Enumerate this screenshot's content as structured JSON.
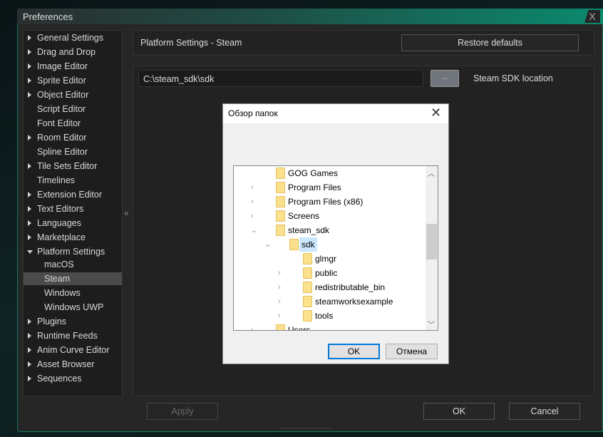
{
  "window": {
    "title": "Preferences",
    "close": "X"
  },
  "sidebar": {
    "items": [
      {
        "label": "General Settings",
        "arrow": "right"
      },
      {
        "label": "Drag and Drop",
        "arrow": "right"
      },
      {
        "label": "Image Editor",
        "arrow": "right"
      },
      {
        "label": "Sprite Editor",
        "arrow": "right"
      },
      {
        "label": "Object Editor",
        "arrow": "right"
      },
      {
        "label": "Script Editor",
        "arrow": ""
      },
      {
        "label": "Font Editor",
        "arrow": ""
      },
      {
        "label": "Room Editor",
        "arrow": "right"
      },
      {
        "label": "Spline Editor",
        "arrow": ""
      },
      {
        "label": "Tile Sets Editor",
        "arrow": "right"
      },
      {
        "label": "Timelines",
        "arrow": ""
      },
      {
        "label": "Extension Editor",
        "arrow": "right"
      },
      {
        "label": "Text Editors",
        "arrow": "right"
      },
      {
        "label": "Languages",
        "arrow": "right"
      },
      {
        "label": "Marketplace",
        "arrow": "right"
      },
      {
        "label": "Platform Settings",
        "arrow": "down"
      },
      {
        "label": "macOS",
        "sub": true
      },
      {
        "label": "Steam",
        "sub": true,
        "selected": true
      },
      {
        "label": "Windows",
        "sub": true
      },
      {
        "label": "Windows UWP",
        "sub": true
      },
      {
        "label": "Plugins",
        "arrow": "right"
      },
      {
        "label": "Runtime Feeds",
        "arrow": "right"
      },
      {
        "label": "Anim Curve Editor",
        "arrow": "right"
      },
      {
        "label": "Asset Browser",
        "arrow": "right"
      },
      {
        "label": "Sequences",
        "arrow": "right"
      }
    ],
    "collapse": "«"
  },
  "panel": {
    "title": "Platform Settings - Steam",
    "restore": "Restore defaults",
    "sdk_path": "C:\\steam_sdk\\sdk",
    "browse": "...",
    "sdk_label": "Steam SDK location"
  },
  "footer": {
    "apply": "Apply",
    "ok": "OK",
    "cancel": "Cancel"
  },
  "dialog": {
    "title": "Обзор папок",
    "close": "✕",
    "ok": "OK",
    "cancel": "Отмена",
    "tree": [
      {
        "label": "GOG Games",
        "level": 0,
        "chev": ""
      },
      {
        "label": "Program Files",
        "level": 0,
        "chev": "›"
      },
      {
        "label": "Program Files (x86)",
        "level": 0,
        "chev": "›"
      },
      {
        "label": "Screens",
        "level": 0,
        "chev": "›"
      },
      {
        "label": "steam_sdk",
        "level": 0,
        "chev": "⌄"
      },
      {
        "label": "sdk",
        "level": 1,
        "chev": "⌄",
        "selected": true
      },
      {
        "label": "glmgr",
        "level": 2,
        "chev": ""
      },
      {
        "label": "public",
        "level": 2,
        "chev": "›"
      },
      {
        "label": "redistributable_bin",
        "level": 2,
        "chev": "›"
      },
      {
        "label": "steamworksexample",
        "level": 2,
        "chev": "›"
      },
      {
        "label": "tools",
        "level": 2,
        "chev": "›"
      },
      {
        "label": "Users",
        "level": 0,
        "chev": "›"
      }
    ]
  }
}
